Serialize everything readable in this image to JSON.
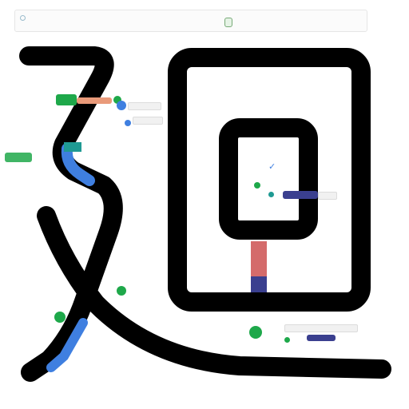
{
  "colors": {
    "stroke": "#000000",
    "accent_blue": "#3f7fe0",
    "accent_green": "#1ea84a",
    "accent_teal": "#1f9a93",
    "accent_navy": "#3a3f8f",
    "accent_red": "#d46b6b",
    "panel_bg": "#fbfbfb"
  },
  "icons": {
    "toolbar_check": "check-icon",
    "toolbar_toggle": "toggle-icon",
    "checkmark": "checkmark-icon"
  },
  "labels": {
    "top_left": "",
    "top_right": "",
    "node_a": "",
    "node_b": "",
    "node_c": "",
    "node_d": "",
    "node_e": "",
    "node_f": ""
  }
}
